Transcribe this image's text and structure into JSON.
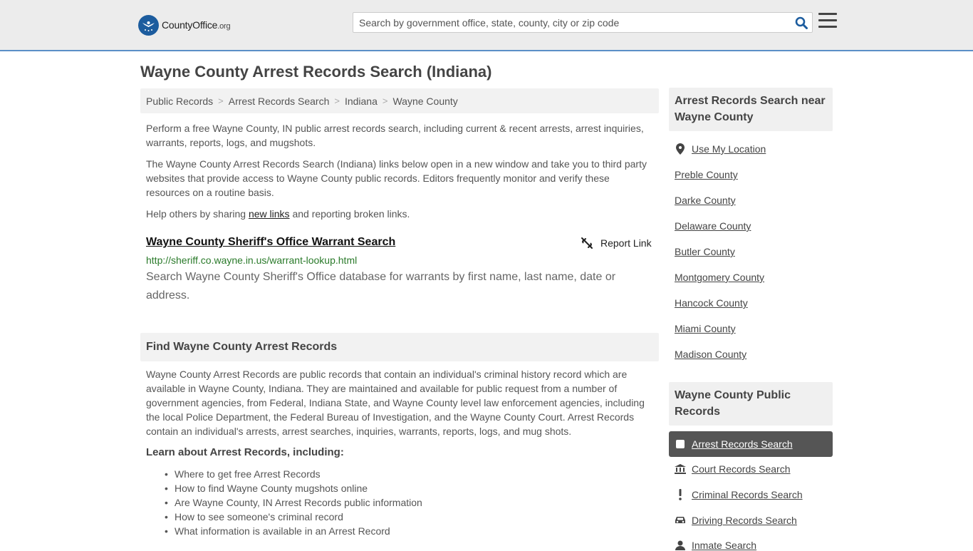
{
  "header": {
    "logo_brand": "CountyOffice",
    "logo_tld": ".org",
    "search_placeholder": "Search by government office, state, county, city or zip code"
  },
  "page_title": "Wayne County Arrest Records Search (Indiana)",
  "breadcrumb": [
    "Public Records",
    "Arrest Records Search",
    "Indiana",
    "Wayne County"
  ],
  "intro": {
    "p1": "Perform a free Wayne County, IN public arrest records search, including current & recent arrests, arrest inquiries, warrants, reports, logs, and mugshots.",
    "p2": "The Wayne County Arrest Records Search (Indiana) links below open in a new window and take you to third party websites that provide access to Wayne County public records. Editors frequently monitor and verify these resources on a routine basis.",
    "p3_before": "Help others by sharing ",
    "p3_link": "new links",
    "p3_after": " and reporting broken links."
  },
  "result": {
    "title": "Wayne County Sheriff's Office Warrant Search",
    "report_label": "Report Link",
    "url": "http://sheriff.co.wayne.in.us/warrant-lookup.html",
    "description": "Search Wayne County Sheriff's Office database for warrants by first name, last name, date or address."
  },
  "find_section": {
    "heading": "Find Wayne County Arrest Records",
    "body": "Wayne County Arrest Records are public records that contain an individual's criminal history record which are available in Wayne County, Indiana. They are maintained and available for public request from a number of government agencies, from Federal, Indiana State, and Wayne County level law enforcement agencies, including the local Police Department, the Federal Bureau of Investigation, and the Wayne County Court. Arrest Records contain an individual's arrests, arrest searches, inquiries, warrants, reports, logs, and mug shots.",
    "learn_heading": "Learn about Arrest Records, including:",
    "learn_items": [
      "Where to get free Arrest Records",
      "How to find Wayne County mugshots online",
      "Are Wayne County, IN Arrest Records public information",
      "How to see someone's criminal record",
      "What information is available in an Arrest Record"
    ]
  },
  "sidebar": {
    "nearby_heading": "Arrest Records Search near Wayne County",
    "use_location": "Use My Location",
    "nearby": [
      "Preble County",
      "Darke County",
      "Delaware County",
      "Butler County",
      "Montgomery County",
      "Hancock County",
      "Miami County",
      "Madison County"
    ],
    "public_heading": "Wayne County Public Records",
    "public_links": [
      {
        "label": "Arrest Records Search",
        "icon": "checkbox-icon"
      },
      {
        "label": "Court Records Search",
        "icon": "courthouse-icon"
      },
      {
        "label": "Criminal Records Search",
        "icon": "exclamation-icon"
      },
      {
        "label": "Driving Records Search",
        "icon": "car-icon"
      },
      {
        "label": "Inmate Search",
        "icon": "person-icon"
      }
    ]
  }
}
